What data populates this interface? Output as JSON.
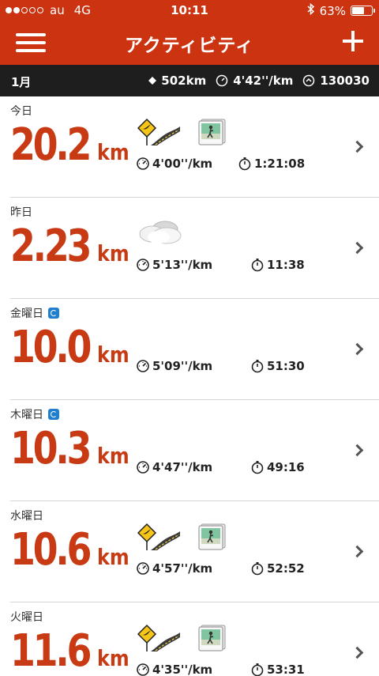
{
  "status_bar": {
    "carrier": "au",
    "network": "4G",
    "time": "10:11",
    "battery": "63%",
    "battery_level": 0.63,
    "signal_bars_filled": 2,
    "signal_bars_total": 5
  },
  "nav": {
    "title": "アクティビティ",
    "menu_icon": "hamburger-menu-icon",
    "add_icon": "plus-icon"
  },
  "summary": {
    "month": "1月",
    "distance": "502km",
    "pace": "4'42''/km",
    "fuel": "130030"
  },
  "colors": {
    "brand": "#cc3411",
    "distance_text": "#c83a13",
    "summary_bg": "#1e1e1e"
  },
  "activities": [
    {
      "day": "今日",
      "synced": false,
      "distance": "20.2",
      "unit": "km",
      "pace": "4'00''/km",
      "time": "1:21:08",
      "icons": [
        "route-sign-icon",
        "photo-icon"
      ]
    },
    {
      "day": "昨日",
      "synced": false,
      "distance": "2.23",
      "unit": "km",
      "pace": "5'13''/km",
      "time": "11:38",
      "icons": [
        "cloudy-weather-icon"
      ]
    },
    {
      "day": "金曜日",
      "synced": true,
      "distance": "10.0",
      "unit": "km",
      "pace": "5'09''/km",
      "time": "51:30",
      "icons": []
    },
    {
      "day": "木曜日",
      "synced": true,
      "distance": "10.3",
      "unit": "km",
      "pace": "4'47''/km",
      "time": "49:16",
      "icons": []
    },
    {
      "day": "水曜日",
      "synced": false,
      "distance": "10.6",
      "unit": "km",
      "pace": "4'57''/km",
      "time": "52:52",
      "icons": [
        "route-sign-icon",
        "photo-icon"
      ]
    },
    {
      "day": "火曜日",
      "synced": false,
      "distance": "11.6",
      "unit": "km",
      "pace": "4'35''/km",
      "time": "53:31",
      "icons": [
        "route-sign-icon",
        "photo-icon"
      ]
    }
  ]
}
